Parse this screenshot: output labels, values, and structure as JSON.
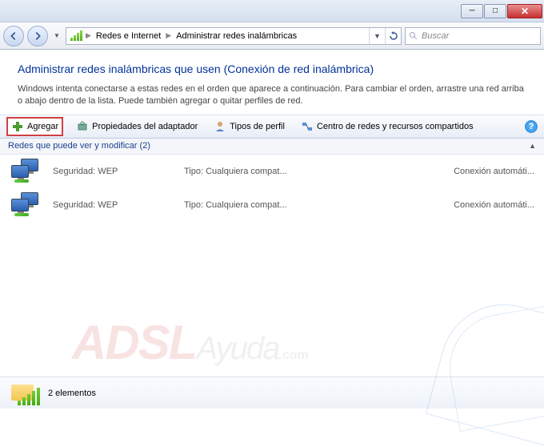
{
  "window": {
    "minimize": "─",
    "maximize": "□",
    "close": "✕"
  },
  "breadcrumbs": {
    "parent": "Redes e Internet",
    "current": "Administrar redes inalámbricas"
  },
  "search": {
    "placeholder": "Buscar"
  },
  "header": {
    "title": "Administrar redes inalámbricas que usen (Conexión de red inalámbrica)",
    "description": "Windows intenta conectarse a estas redes en el orden que aparece a continuación. Para cambiar el orden, arrastre una red arriba o abajo dentro de la lista. Puede también agregar o quitar perfiles de red."
  },
  "toolbar": {
    "add": "Agregar",
    "adapter": "Propiedades del adaptador",
    "profile": "Tipos de perfil",
    "center": "Centro de redes y recursos compartidos"
  },
  "group": {
    "label": "Redes que puede ver y modificar (2)"
  },
  "columns": {
    "sec_label": "Seguridad:",
    "tipo_label": "Tipo:"
  },
  "networks": [
    {
      "security": "WEP",
      "type": "Cualquiera compat...",
      "connection": "Conexión automáti..."
    },
    {
      "security": "WEP",
      "type": "Cualquiera compat...",
      "connection": "Conexión automáti..."
    }
  ],
  "status": {
    "count": "2 elementos"
  },
  "watermark": {
    "part1": "ADSL",
    "part2": "Ayuda",
    "part3": ".com"
  }
}
